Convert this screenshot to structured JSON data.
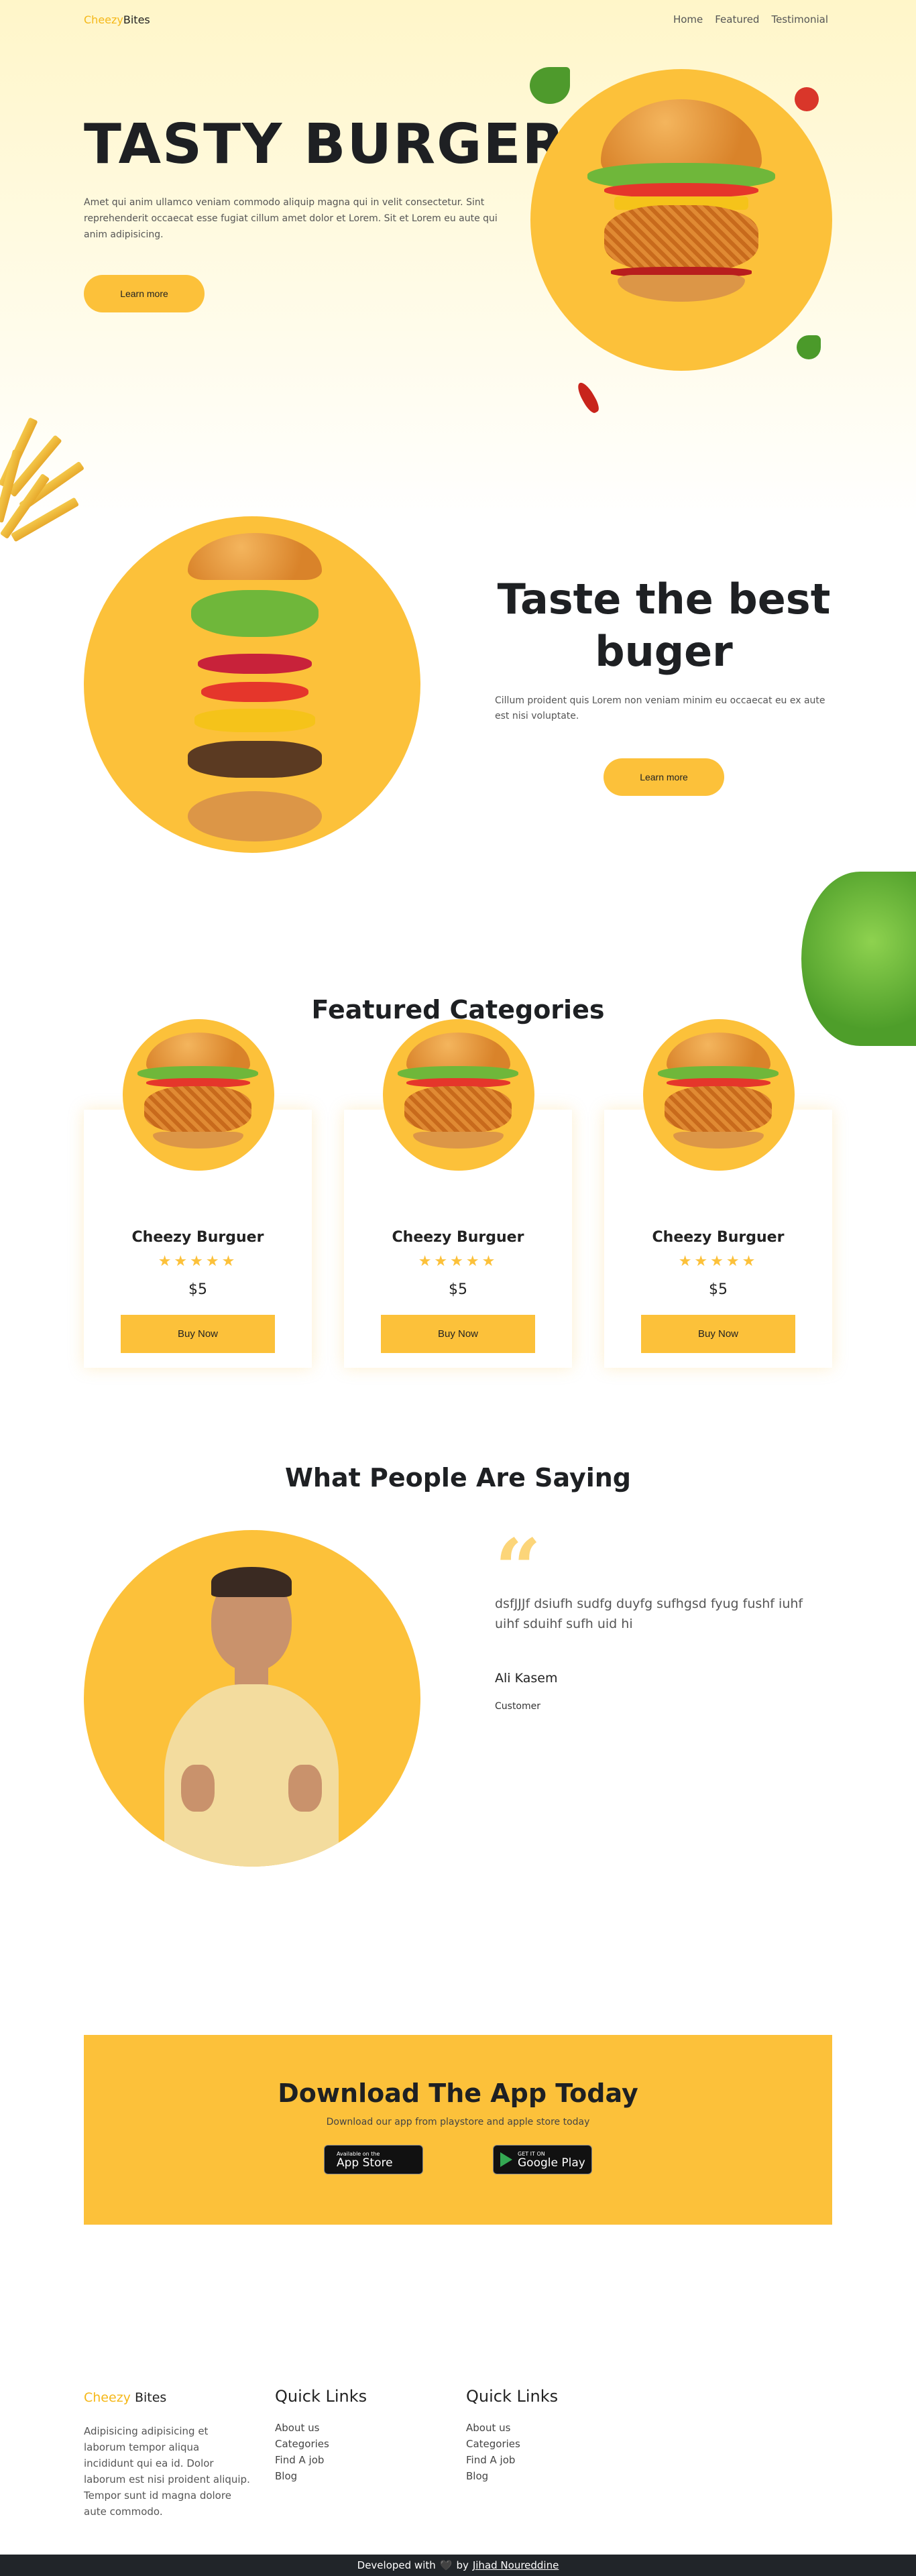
{
  "nav": {
    "logo_part1": "Cheezy",
    "logo_part2": "Bites",
    "links": [
      "Home",
      "Featured",
      "Testimonial"
    ]
  },
  "hero": {
    "title": "TASTY BURGER",
    "text": "Amet qui anim ullamco veniam commodo aliquip magna qui in velit consectetur. Sint reprehenderit occaecat esse fugiat cillum amet dolor et Lorem. Sit et Lorem eu aute qui anim adipisicing.",
    "button": "Learn more"
  },
  "section2": {
    "title": "Taste the best buger",
    "text": "Cillum proident quis Lorem non veniam minim eu occaecat eu ex aute est nisi voluptate.",
    "button": "Learn more"
  },
  "featured": {
    "title": "Featured Categories",
    "cards": [
      {
        "name": "Cheezy Burguer",
        "stars": "★★★★★",
        "price": "$5",
        "button": "Buy Now"
      },
      {
        "name": "Cheezy Burguer",
        "stars": "★★★★★",
        "price": "$5",
        "button": "Buy Now"
      },
      {
        "name": "Cheezy Burguer",
        "stars": "★★★★★",
        "price": "$5",
        "button": "Buy Now"
      }
    ]
  },
  "testimonial": {
    "title": "What People Are Saying",
    "quote_mark": "“",
    "text": "dsfJJJf dsiufh sudfg duyfg sufhgsd fyug fushf iuhf uihf sduihf sufh uid hi",
    "name": "Ali Kasem",
    "role": "Customer"
  },
  "app": {
    "title": "Download The App Today",
    "subtitle": "Download our app from playstore and apple store today",
    "appstore_small": "Available on the",
    "appstore_big": "App Store",
    "googleplay_small": "GET IT ON",
    "googleplay_big": "Google Play"
  },
  "footer": {
    "logo_part1": "Cheezy",
    "logo_part2": " Bites",
    "text": "Adipisicing adipisicing et laborum tempor aliqua incididunt qui ea id. Dolor laborum est nisi proident aliquip. Tempor sunt id magna dolore aute commodo.",
    "col1_title": "Quick Links",
    "col1_links": [
      "About us",
      "Categories",
      "Find A job",
      "Blog"
    ],
    "col2_title": "Quick Links",
    "col2_links": [
      "About us",
      "Categories",
      "Find A job",
      "Blog"
    ]
  },
  "bottom_bar": {
    "prefix": "Developed with",
    "heart": "🖤",
    "by": "by",
    "author": "Jihad Noureddine"
  },
  "colors": {
    "accent": "#fcc13a",
    "dark": "#1e2023",
    "footer_bar": "#212529"
  }
}
